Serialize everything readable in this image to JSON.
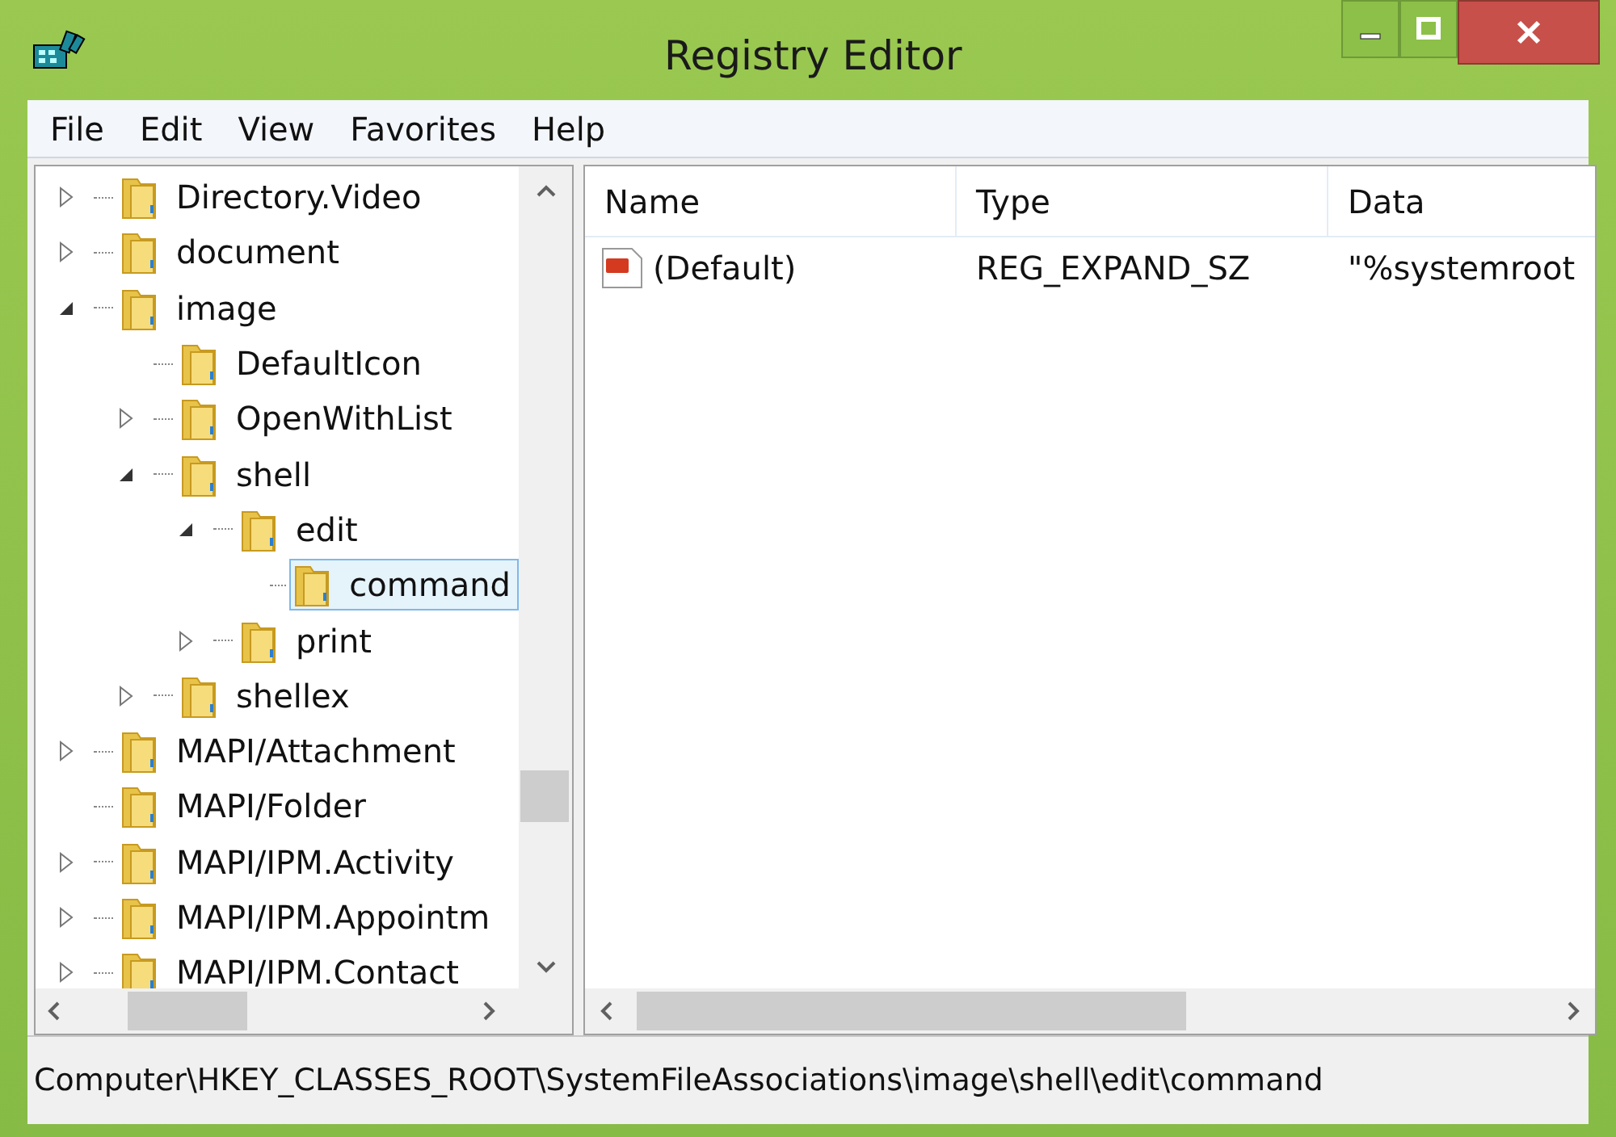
{
  "window": {
    "title": "Registry Editor"
  },
  "menu": [
    "File",
    "Edit",
    "View",
    "Favorites",
    "Help"
  ],
  "tree": [
    {
      "label": "Directory.Video",
      "expanded": false,
      "selected": false
    },
    {
      "label": "document",
      "expanded": false,
      "selected": false
    },
    {
      "label": "image",
      "expanded": true,
      "selected": false,
      "children": [
        {
          "label": "DefaultIcon",
          "selected": false
        },
        {
          "label": "OpenWithList",
          "expanded": false,
          "selected": false
        },
        {
          "label": "shell",
          "expanded": true,
          "selected": false,
          "children": [
            {
              "label": "edit",
              "expanded": true,
              "selected": false,
              "children": [
                {
                  "label": "command",
                  "selected": true
                }
              ]
            },
            {
              "label": "print",
              "expanded": false,
              "selected": false
            }
          ]
        },
        {
          "label": "shellex",
          "expanded": false,
          "selected": false
        }
      ]
    },
    {
      "label": "MAPI/Attachment",
      "expanded": false,
      "selected": false
    },
    {
      "label": "MAPI/Folder",
      "selected": false
    },
    {
      "label": "MAPI/IPM.Activity",
      "expanded": false,
      "selected": false
    },
    {
      "label": "MAPI/IPM.Appointm",
      "expanded": false,
      "selected": false
    },
    {
      "label": "MAPI/IPM.Contact",
      "expanded": false,
      "selected": false
    }
  ],
  "values": {
    "columns": [
      "Name",
      "Type",
      "Data"
    ],
    "rows": [
      {
        "name": "(Default)",
        "type": "REG_EXPAND_SZ",
        "data": "\"%systemroot"
      }
    ]
  },
  "status_bar": "Computer\\HKEY_CLASSES_ROOT\\SystemFileAssociations\\image\\shell\\edit\\command"
}
